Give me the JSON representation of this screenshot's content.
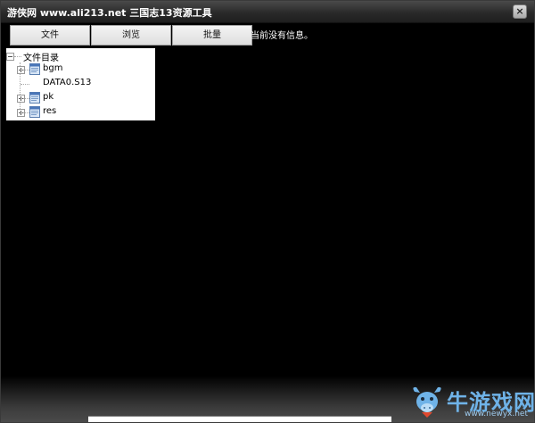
{
  "window": {
    "title": "游侠网 www.ali213.net 三国志13资源工具",
    "close_glyph": "×"
  },
  "toolbar": {
    "buttons": [
      {
        "label": "文件"
      },
      {
        "label": "浏览"
      },
      {
        "label": "批量"
      }
    ]
  },
  "status": {
    "text": "当前没有信息。"
  },
  "tree": {
    "root_label": "文件目录",
    "nodes": [
      {
        "label": "bgm",
        "icon": "folder-icon",
        "expandable": true
      },
      {
        "label": "DATA0.S13",
        "icon": "file-icon",
        "expandable": false
      },
      {
        "label": "pk",
        "icon": "folder-icon",
        "expandable": true
      },
      {
        "label": "res",
        "icon": "folder-icon",
        "expandable": true
      }
    ]
  },
  "watermark": {
    "brand": "牛游戏网",
    "url": "www.newyx.net",
    "color": "#6fb3e8"
  }
}
